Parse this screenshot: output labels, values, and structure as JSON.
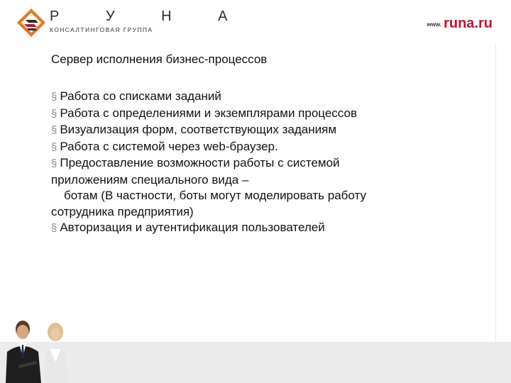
{
  "header": {
    "logo_letters": "Р У Н А",
    "logo_tagline": "КОНСАЛТИНГОВАЯ ГРУППА",
    "site_www": "www.",
    "site_domain": "runa.ru"
  },
  "slide": {
    "title": "Сервер исполнения бизнес-процессов",
    "bullet_symbol": "§",
    "bullets": [
      "Работа со списками заданий",
      "Работа с определениями и экземплярами процессов",
      "Визуализация форм, соответствующих заданиям",
      "Работа с системой через web-браузер.",
      "Предоставление возможности работы с системой",
      "Авторизация и аутентификация пользователей"
    ],
    "continuation_lines": [
      "приложениям специального вида –",
      "ботам (В частности, боты могут моделировать работу",
      "сотрудника предприятия)"
    ]
  },
  "colors": {
    "brand_red": "#c8102e",
    "logo_orange": "#e87722",
    "bottom_band": "#ececec"
  }
}
